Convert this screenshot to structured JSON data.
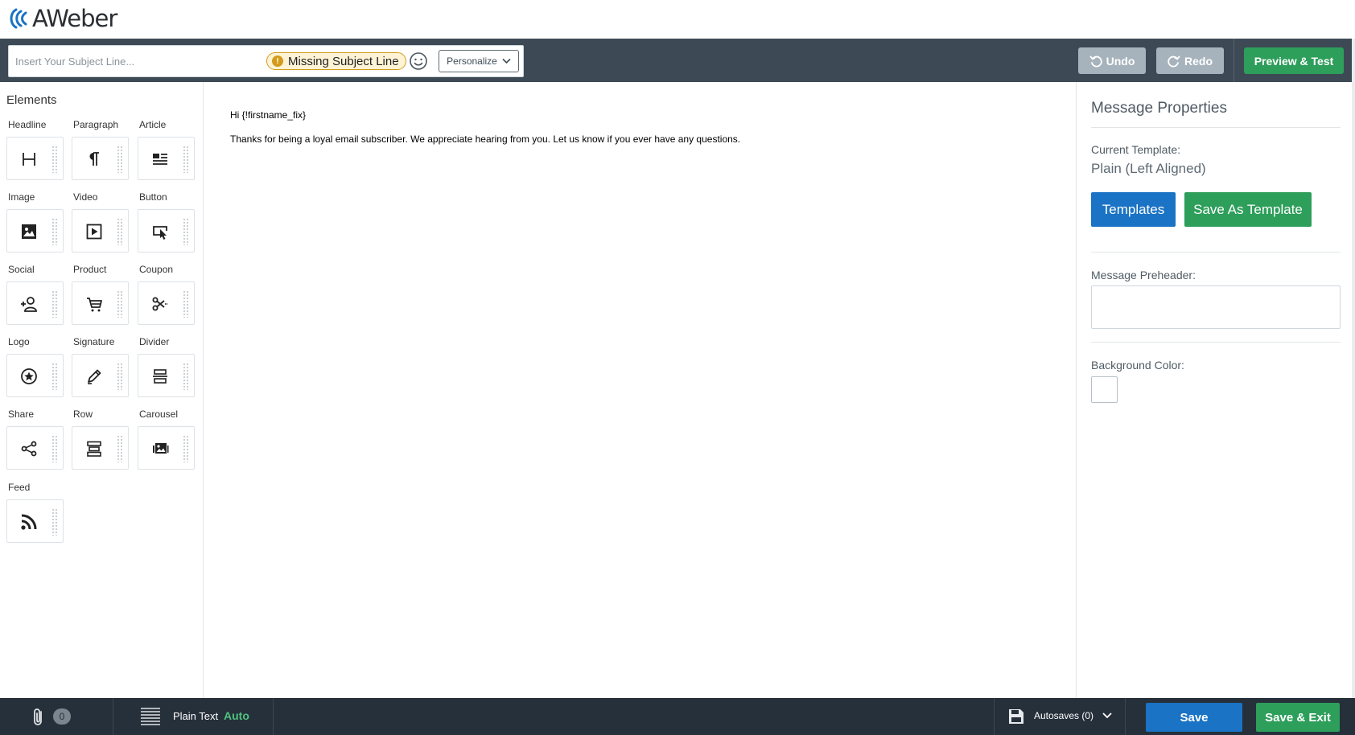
{
  "brand": {
    "name": "AWeber",
    "color": "#1a73c4"
  },
  "toolbar": {
    "subject_placeholder": "Insert Your Subject Line...",
    "subject_value": "",
    "missing_badge": "Missing Subject Line",
    "personalize_label": "Personalize",
    "undo_label": "Undo",
    "redo_label": "Redo",
    "preview_label": "Preview & Test"
  },
  "elements": {
    "title": "Elements",
    "items": [
      {
        "label": "Headline",
        "icon": "headline-icon"
      },
      {
        "label": "Paragraph",
        "icon": "paragraph-icon"
      },
      {
        "label": "Article",
        "icon": "article-icon"
      },
      {
        "label": "Image",
        "icon": "image-icon"
      },
      {
        "label": "Video",
        "icon": "video-icon"
      },
      {
        "label": "Button",
        "icon": "button-cursor-icon"
      },
      {
        "label": "Social",
        "icon": "social-follow-icon"
      },
      {
        "label": "Product",
        "icon": "cart-icon"
      },
      {
        "label": "Coupon",
        "icon": "scissors-icon"
      },
      {
        "label": "Logo",
        "icon": "logo-star-icon"
      },
      {
        "label": "Signature",
        "icon": "pen-icon"
      },
      {
        "label": "Divider",
        "icon": "divider-icon"
      },
      {
        "label": "Share",
        "icon": "share-icon"
      },
      {
        "label": "Row",
        "icon": "row-icon"
      },
      {
        "label": "Carousel",
        "icon": "carousel-icon"
      },
      {
        "label": "Feed",
        "icon": "rss-icon"
      }
    ]
  },
  "message": {
    "greeting": "Hi {!firstname_fix}",
    "body": "Thanks for being a loyal email subscriber. We appreciate hearing from you. Let us know if you ever have any questions."
  },
  "properties": {
    "title": "Message Properties",
    "current_template_label": "Current Template:",
    "current_template_value": "Plain (Left Aligned)",
    "templates_button": "Templates",
    "save_as_template_button": "Save As Template",
    "preheader_label": "Message Preheader:",
    "preheader_value": "",
    "background_label": "Background Color:",
    "background_color": "#ffffff"
  },
  "bottom": {
    "attachments_count": "0",
    "plain_text_label": "Plain Text",
    "plain_text_mode": "Auto",
    "autosaves_label": "Autosaves (0)",
    "save_label": "Save",
    "save_exit_label": "Save & Exit"
  },
  "colors": {
    "toolbar_bg": "#3d4a55",
    "bottombar_bg": "#26303a",
    "primary_blue": "#1a73c4",
    "primary_green": "#2e9e5b",
    "warning": "#d49b1a"
  }
}
